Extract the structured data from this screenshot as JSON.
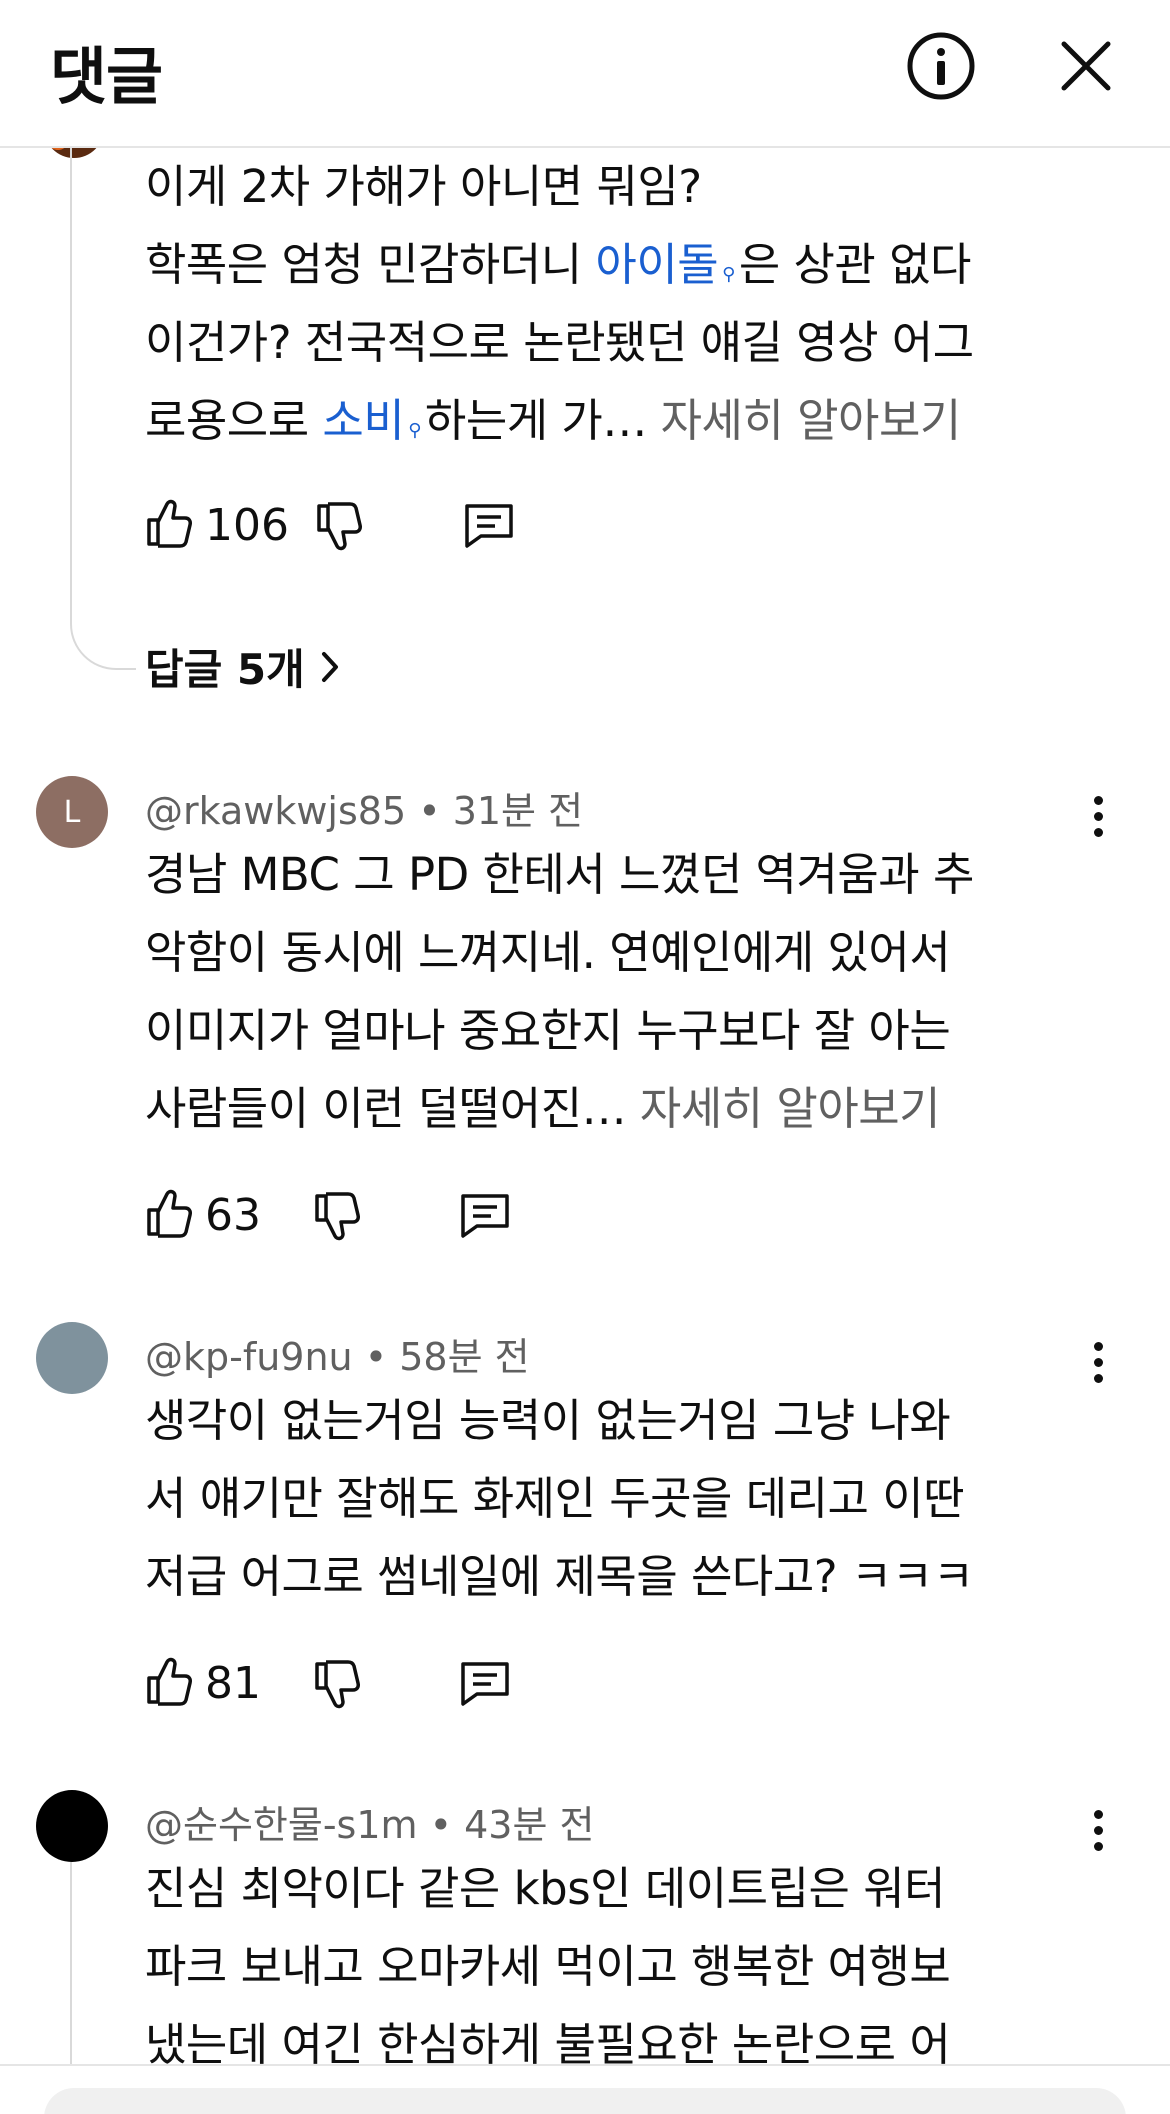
{
  "header": {
    "title": "댓글"
  },
  "comments": [
    {
      "lines": [
        "이게 2차 가해가 아니면 뭐임?",
        "학폭은 엄청 민감하더니",
        "은 상관 없다",
        "이건가? 전국적으로 논란됐던 얘길 영상 어그",
        "로용으로",
        "하는게 가…"
      ],
      "links": [
        "아이돌",
        "소비"
      ],
      "more_label": "자세히 알아보기",
      "likes": "106",
      "replies_label": "답글 5개"
    },
    {
      "avatar_letter": "L",
      "author": "@rkawkwjs85",
      "time": "31분 전",
      "lines": [
        "경남 MBC 그 PD 한테서 느꼈던 역겨움과 추",
        "악함이 동시에 느껴지네. 연예인에게 있어서",
        "이미지가 얼마나 중요한지 누구보다 잘 아는",
        "사람들이 이런 덜떨어진…"
      ],
      "more_label": "자세히 알아보기",
      "likes": "63"
    },
    {
      "author": "@kp-fu9nu",
      "time": "58분 전",
      "lines": [
        "생각이 없는거임 능력이 없는거임 그냥 나와",
        "서 얘기만 잘해도 화제인 두곳을 데리고 이딴",
        "저급 어그로 썸네일에 제목을 쓴다고? ㅋㅋㅋ"
      ],
      "likes": "81"
    },
    {
      "author": "@순수한물-s1m",
      "time": "43분 전",
      "lines": [
        "진심 최악이다 같은 kbs인 데이트립은 워터",
        "파크 보내고 오마카세 먹이고 행복한 여행보",
        "냈는데 여긴 한심하게 불필요한 논란으로 어"
      ]
    }
  ],
  "colors": {
    "link": "#1a5fd0",
    "muted": "#606060",
    "avatar_l": "#8d6e63",
    "avatar_grey": "#7f929d",
    "avatar_black": "#000000"
  }
}
